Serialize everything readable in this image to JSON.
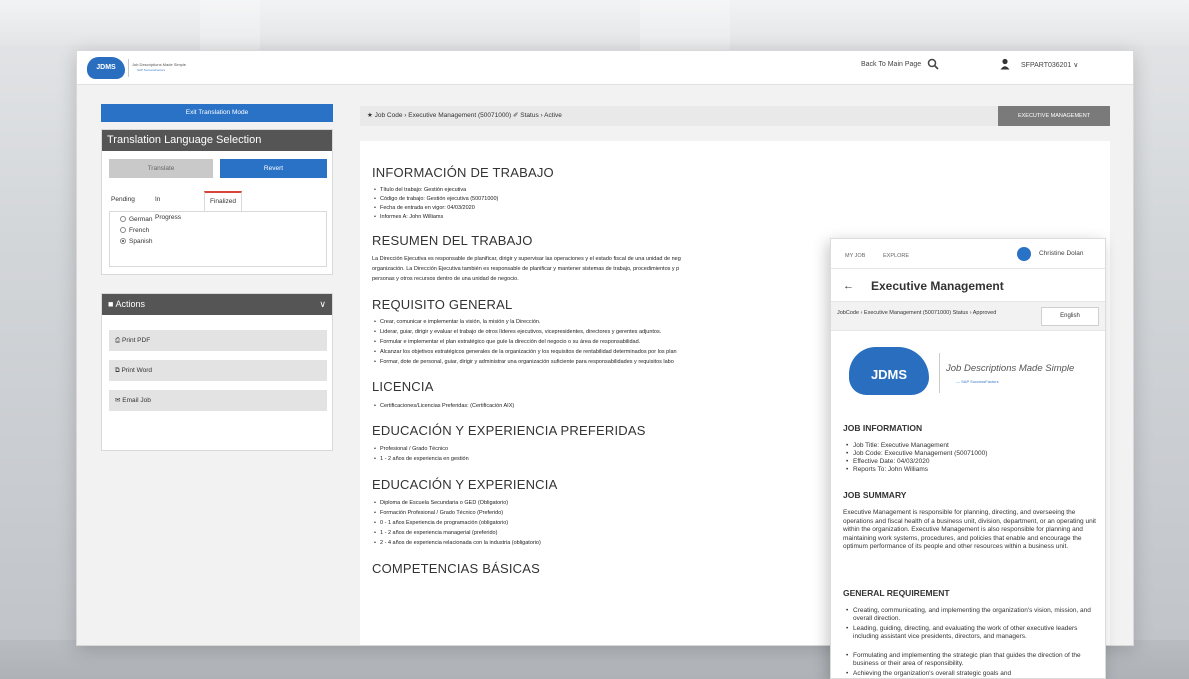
{
  "topbar": {
    "logo": "JDMS",
    "logo_tagline": "Job Descriptions Made Simple",
    "logo_sub": "SAP SuccessFactors",
    "back_link": "Back To Main Page",
    "account": "SFPART036201 ∨"
  },
  "left": {
    "exit_button": "Exit Translation Mode",
    "lang_panel_title": "Translation Language Selection",
    "translate_button": "Translate",
    "revert_button": "Revert",
    "tabs": [
      "Pending",
      "In Progress",
      "Finalized"
    ],
    "languages": [
      "German",
      "French",
      "Spanish"
    ],
    "actions_title": "Actions",
    "actions": [
      "Print PDF",
      "Print Word",
      "Email Job"
    ]
  },
  "breadcrumb": {
    "text": "★ Job Code  ›  Executive Management (50071000)  ✐ Status  ›  Active",
    "tag": "EXECUTIVE MANAGEMENT"
  },
  "content": {
    "h_info": "INFORMACIÓN DE TRABAJO",
    "info": [
      "Título del trabajo: Gestión ejecutiva",
      "Código de trabajo: Gestión ejecutiva (50071000)",
      "Fecha de entrada en vigor: 04/03/2020",
      "Informes A: John Williams"
    ],
    "h_summary": "RESUMEN DEL TRABAJO",
    "summary_lines": [
      "La Dirección Ejecutiva es responsable de planificar, dirigir y supervisar las operaciones y el estado fiscal de una unidad de neg",
      "organización. La Dirección Ejecutiva también es responsable de planificar y mantener sistemas de trabajo, procedimientos y p",
      "personas y otros recursos dentro de una unidad de negocio."
    ],
    "h_req": "REQUISITO GENERAL",
    "req": [
      "Crear, comunicar e implementar la visión, la misión y la Dirección.",
      "Liderar, guiar, dirigir y evaluar el trabajo de otros líderes ejecutivos, vicepresidentes, directores y gerentes adjuntos.",
      "Formular e implementar el plan estratégico que guíe la dirección del negocio o su área de responsabilidad.",
      "Alcanzar los objetivos estratégicos generales de la organización y los requisitos de rentabilidad determinados por los plan",
      "Formar, dote de personal, guiar, dirigir y administrar una organización suficiente para responsabilidades y requisitos labo"
    ],
    "h_lic": "LICENCIA",
    "lic": [
      "Certificaciones/Licencias Preferidas: (Certificación AIX)"
    ],
    "h_edu_pref": "EDUCACIÓN Y EXPERIENCIA PREFERIDAS",
    "edu_pref": [
      "Profesional / Grado Técnico",
      "1 - 2 años de experiencia en gestión"
    ],
    "h_edu": "EDUCACIÓN Y EXPERIENCIA",
    "edu": [
      "Diploma de Escuela Secundaria o GED (Obligatorio)",
      "Formación Profesional / Grado Técnico (Preferido)",
      "0 - 1 años Experiencia de programación (obligatorio)",
      "1 - 2 años de experiencia managerial (preferido)",
      "2 - 4 años de experiencia relacionada con la industria (obligatorio)"
    ],
    "h_comp": "COMPETENCIAS BÁSICAS"
  },
  "overlay": {
    "tabs": [
      "MY JOB",
      "EXPLORE"
    ],
    "user": "Christine Dolan",
    "title": "Executive Management",
    "crumb": "JobCode  ›  Executive Management (50071000)  Status  ›  Approved",
    "language": "English",
    "logo": "JDMS",
    "brand": "Job Descriptions Made Simple",
    "brand_sub": "— SAP SuccessFactors",
    "h_info": "JOB INFORMATION",
    "info": [
      "Job Title: Executive Management",
      "Job Code: Executive Management (50071000)",
      "Effective Date: 04/03/2020",
      "Reports To: John Williams"
    ],
    "h_summary": "JOB SUMMARY",
    "summary": "Executive Management is responsible for planning, directing, and overseeing the operations and fiscal health of a business unit, division, department, or an operating unit within the organization. Executive Management is also responsible for planning and maintaining work systems, procedures, and policies that enable and encourage the optimum performance of its people and other resources within a business unit.",
    "h_req": "GENERAL REQUIREMENT",
    "req": [
      "Creating, communicating, and implementing the organization's vision, mission, and overall direction.",
      "Leading, guiding, directing, and evaluating the work of other executive leaders including assistant vice presidents, directors, and managers.",
      "Formulating and implementing the strategic plan that guides the direction of the business or their area of responsibility.",
      "Achieving the organization's overall strategic goals and"
    ]
  }
}
